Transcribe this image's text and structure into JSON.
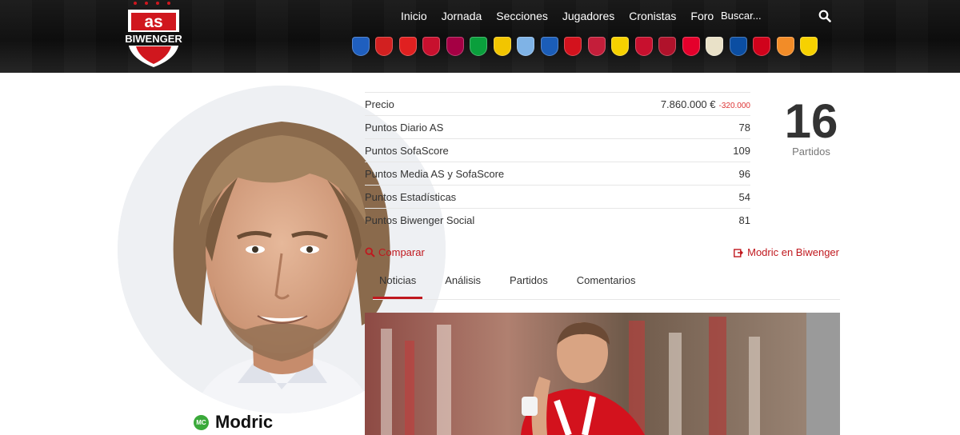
{
  "header": {
    "logo": {
      "brand": "as",
      "sub": "BIWENGER"
    },
    "nav": [
      "Inicio",
      "Jornada",
      "Secciones",
      "Jugadores",
      "Cronistas",
      "Foro"
    ],
    "search": {
      "placeholder": "Buscar..."
    },
    "teams": [
      {
        "name": "alaves-badge",
        "color": "#1f5fbf"
      },
      {
        "name": "almeria-badge",
        "color": "#d22020"
      },
      {
        "name": "athletic-badge",
        "color": "#e02020"
      },
      {
        "name": "atletico-badge",
        "color": "#c8102e"
      },
      {
        "name": "barcelona-badge",
        "color": "#a50044"
      },
      {
        "name": "betis-badge",
        "color": "#0a9f3c"
      },
      {
        "name": "cadiz-badge",
        "color": "#f2c500"
      },
      {
        "name": "celta-badge",
        "color": "#7fb3e6"
      },
      {
        "name": "getafe-badge",
        "color": "#1b5db8"
      },
      {
        "name": "girona-badge",
        "color": "#d3121d"
      },
      {
        "name": "granada-badge",
        "color": "#c41e3a"
      },
      {
        "name": "laspalmas-badge",
        "color": "#f7d100"
      },
      {
        "name": "mallorca-badge",
        "color": "#c8102e"
      },
      {
        "name": "osasuna-badge",
        "color": "#b0122b"
      },
      {
        "name": "rayo-badge",
        "color": "#e4002b"
      },
      {
        "name": "realmadrid-badge",
        "color": "#e9e1c8"
      },
      {
        "name": "realsociedad-badge",
        "color": "#0b4ea2"
      },
      {
        "name": "sevilla-badge",
        "color": "#d0021b"
      },
      {
        "name": "valencia-badge",
        "color": "#f28c28"
      },
      {
        "name": "villarreal-badge",
        "color": "#f7d100"
      }
    ]
  },
  "player": {
    "name": "Modric",
    "position": "MC"
  },
  "stats": [
    {
      "label": "Precio",
      "value": "7.860.000 €",
      "delta": "-320.000"
    },
    {
      "label": "Puntos Diario AS",
      "value": "78"
    },
    {
      "label": "Puntos SofaScore",
      "value": "109"
    },
    {
      "label": "Puntos Media AS y SofaScore",
      "value": "96"
    },
    {
      "label": "Puntos Estadísticas",
      "value": "54"
    },
    {
      "label": "Puntos Biwenger Social",
      "value": "81"
    }
  ],
  "matches": {
    "count": "16",
    "label": "Partidos"
  },
  "links": {
    "compare": "Comparar",
    "biwenger": "Modric en Biwenger"
  },
  "tabs": [
    "Noticias",
    "Análisis",
    "Partidos",
    "Comentarios"
  ],
  "active_tab": "Noticias",
  "colors": {
    "accent": "#c0181e",
    "position_badge": "#3aa93a"
  }
}
